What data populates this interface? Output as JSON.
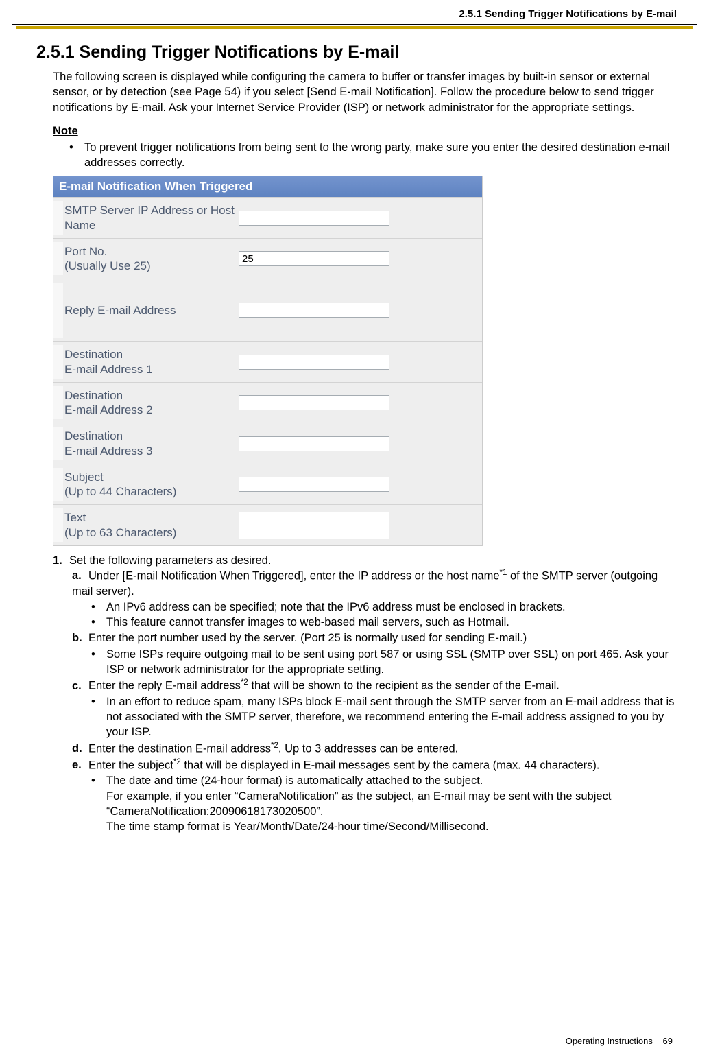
{
  "header": {
    "section_ref": "2.5.1 Sending Trigger Notifications by E-mail"
  },
  "title": "2.5.1  Sending Trigger Notifications by E-mail",
  "intro": "The following screen is displayed while configuring the camera to buffer or transfer images by built-in sensor or external sensor, or by detection (see Page 54) if you select [Send E-mail Notification]. Follow the procedure below to send trigger notifications by E-mail. Ask your Internet Service Provider (ISP) or network administrator for the appropriate settings.",
  "note_label": "Note",
  "note_bullet": "To prevent trigger notifications from being sent to the wrong party, make sure you enter the desired destination e-mail addresses correctly.",
  "form": {
    "title": "E-mail Notification When Triggered",
    "rows": {
      "smtp": {
        "label": "SMTP Server IP Address or Host Name",
        "value": ""
      },
      "port": {
        "label": "Port No.\n(Usually Use 25)",
        "value": "25"
      },
      "reply": {
        "label": "Reply E-mail Address",
        "value": ""
      },
      "dest1": {
        "label": "Destination\nE-mail Address 1",
        "value": ""
      },
      "dest2": {
        "label": "Destination\nE-mail Address 2",
        "value": ""
      },
      "dest3": {
        "label": "Destination\nE-mail Address 3",
        "value": ""
      },
      "subject": {
        "label": "Subject\n(Up to 44 Characters)",
        "value": ""
      },
      "text": {
        "label": "Text\n(Up to 63 Characters)",
        "value": ""
      }
    }
  },
  "steps": {
    "s1": {
      "num": "1.",
      "text": "Set the following parameters as desired.",
      "subs": {
        "a": {
          "letter": "a.",
          "text_pre": "Under [E-mail Notification When Triggered], enter the IP address or the host name",
          "sup": "*1",
          "text_post": " of the SMTP server (outgoing mail server).",
          "bullets": [
            "An IPv6 address can be specified; note that the IPv6 address must be enclosed in brackets.",
            "This feature cannot transfer images to web-based mail servers, such as Hotmail."
          ]
        },
        "b": {
          "letter": "b.",
          "text": "Enter the port number used by the server. (Port 25 is normally used for sending E-mail.)",
          "bullets": [
            "Some ISPs require outgoing mail to be sent using port 587 or using SSL (SMTP over SSL) on port 465. Ask your ISP or network administrator for the appropriate setting."
          ]
        },
        "c": {
          "letter": "c.",
          "text_pre": "Enter the reply E-mail address",
          "sup": "*2",
          "text_post": " that will be shown to the recipient as the sender of the E-mail.",
          "bullets": [
            "In an effort to reduce spam, many ISPs block E-mail sent through the SMTP server from an E-mail address that is not associated with the SMTP server, therefore, we recommend entering the E-mail address assigned to you by your ISP."
          ]
        },
        "d": {
          "letter": "d.",
          "text_pre": "Enter the destination E-mail address",
          "sup": "*2",
          "text_post": ". Up to 3 addresses can be entered."
        },
        "e": {
          "letter": "e.",
          "text_pre": "Enter the subject",
          "sup": "*2",
          "text_post": " that will be displayed in E-mail messages sent by the camera (max. 44 characters).",
          "bullets": [
            "The date and time (24-hour format) is automatically attached to the subject.\nFor example, if you enter “CameraNotification” as the subject, an E-mail may be sent with the subject “CameraNotification:20090618173020500”.\nThe time stamp format is Year/Month/Date/24-hour time/Second/Millisecond."
          ]
        }
      }
    }
  },
  "footer": {
    "doc": "Operating Instructions",
    "page": "69"
  }
}
